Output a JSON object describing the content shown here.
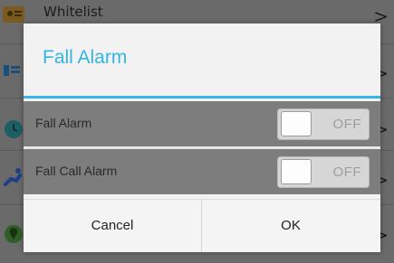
{
  "background": {
    "list_items": [
      {
        "label": "Whitelist",
        "icon": "contact-card-icon",
        "chevron": ">"
      },
      {
        "label": "",
        "icon": "list-icon",
        "chevron": ">"
      },
      {
        "label": "",
        "icon": "clock-icon",
        "chevron": ">"
      },
      {
        "label": "",
        "icon": "fall-person-icon",
        "chevron": ">"
      },
      {
        "label": "",
        "icon": "location-icon",
        "chevron": ">"
      }
    ]
  },
  "dialog": {
    "title": "Fall Alarm",
    "settings": [
      {
        "label": "Fall Alarm",
        "toggle_state": "OFF"
      },
      {
        "label": "Fall Call Alarm",
        "toggle_state": "OFF"
      }
    ],
    "cancel_label": "Cancel",
    "ok_label": "OK"
  },
  "colors": {
    "accent": "#33b5e5",
    "dim_overlay": "#6a6a6a",
    "row_background": "#7d7d7d",
    "dialog_background": "#f2f2f2"
  }
}
